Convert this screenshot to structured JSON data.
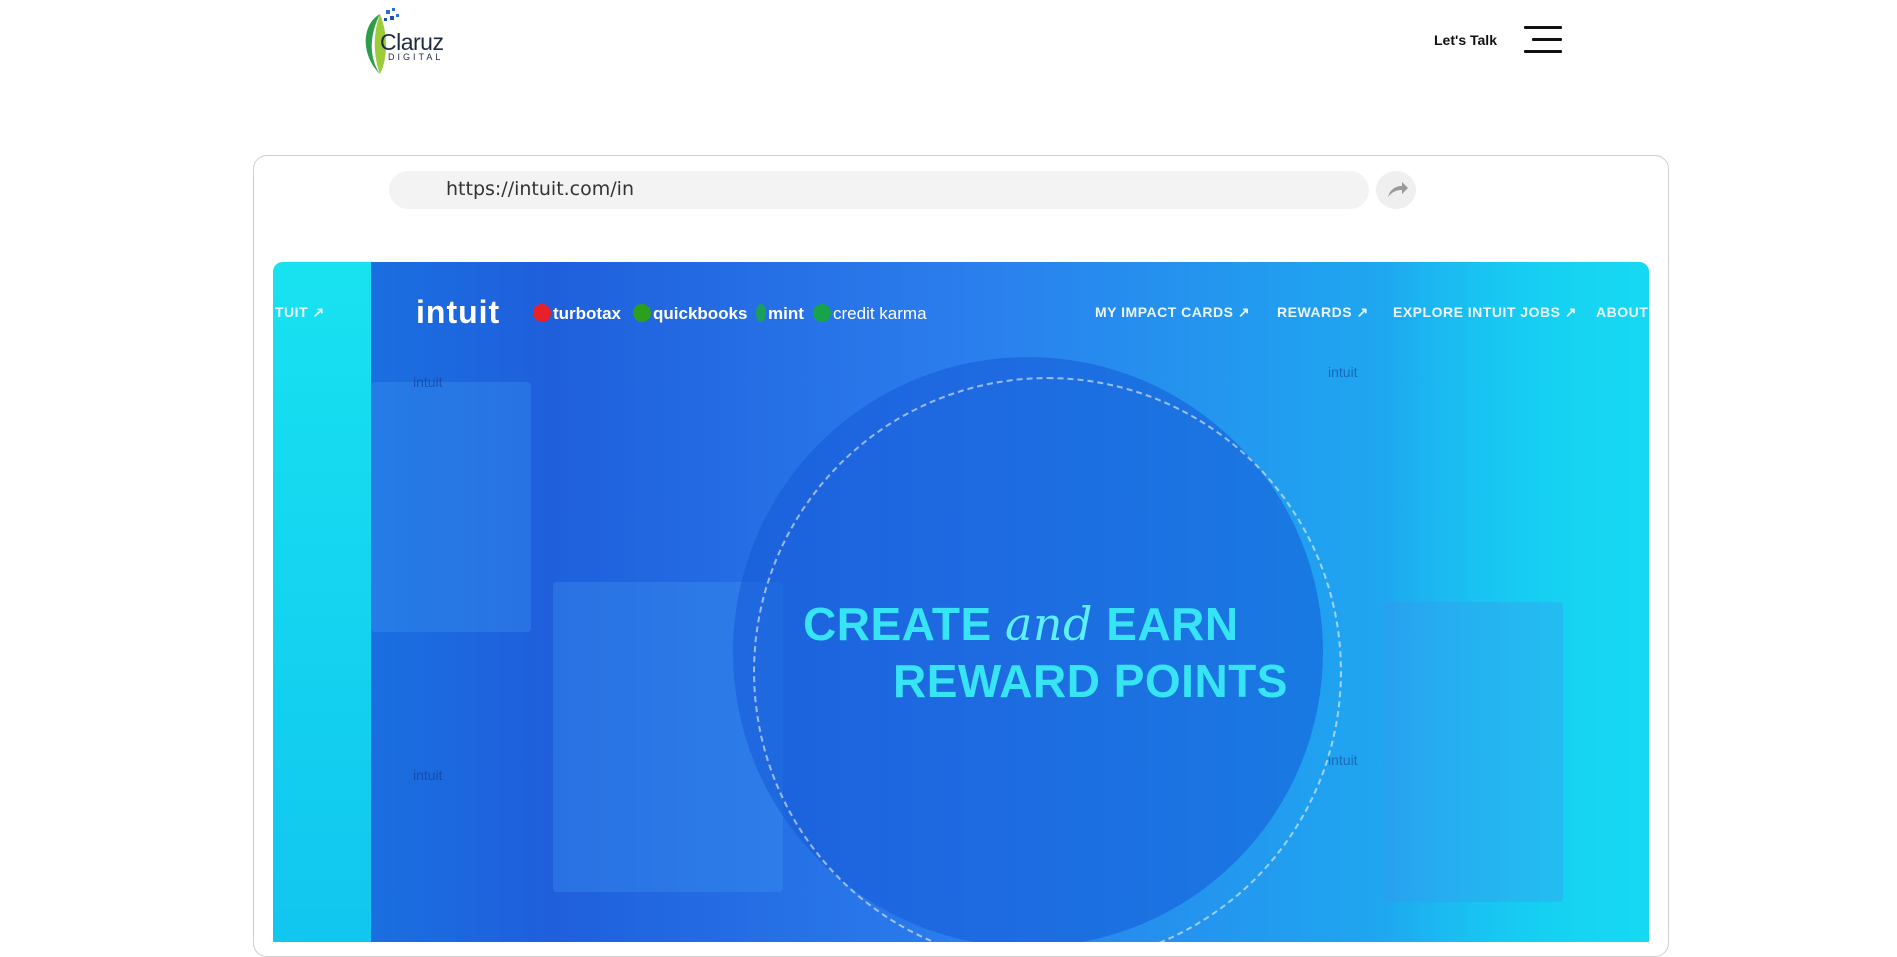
{
  "header": {
    "logo_text": "Claruz",
    "logo_sub": "DIGITAL",
    "lets_talk": "Let's Talk",
    "menu_icon": "hamburger-icon"
  },
  "browser": {
    "url": "https://intuit.com/in",
    "share_icon": "share-arrow-icon"
  },
  "hero": {
    "nav_left": "TUIT ↗",
    "brand_intuit": "intuit",
    "brands": [
      "turbotax",
      "quickbooks",
      "mint",
      "credit karma"
    ],
    "nav_items": [
      "MY IMPACT CARDS ↗",
      "REWARDS ↗",
      "EXPLORE INTUIT JOBS ↗",
      "ABOUT IN"
    ],
    "headline_1a": "CREATE",
    "headline_1b": "and",
    "headline_1c": "EARN",
    "headline_2": "REWARD POINTS",
    "watermark": "intuit",
    "colors": {
      "cyan": "#12d4f2",
      "blue": "#1f5fdc",
      "headline": "#37e4f4"
    }
  }
}
